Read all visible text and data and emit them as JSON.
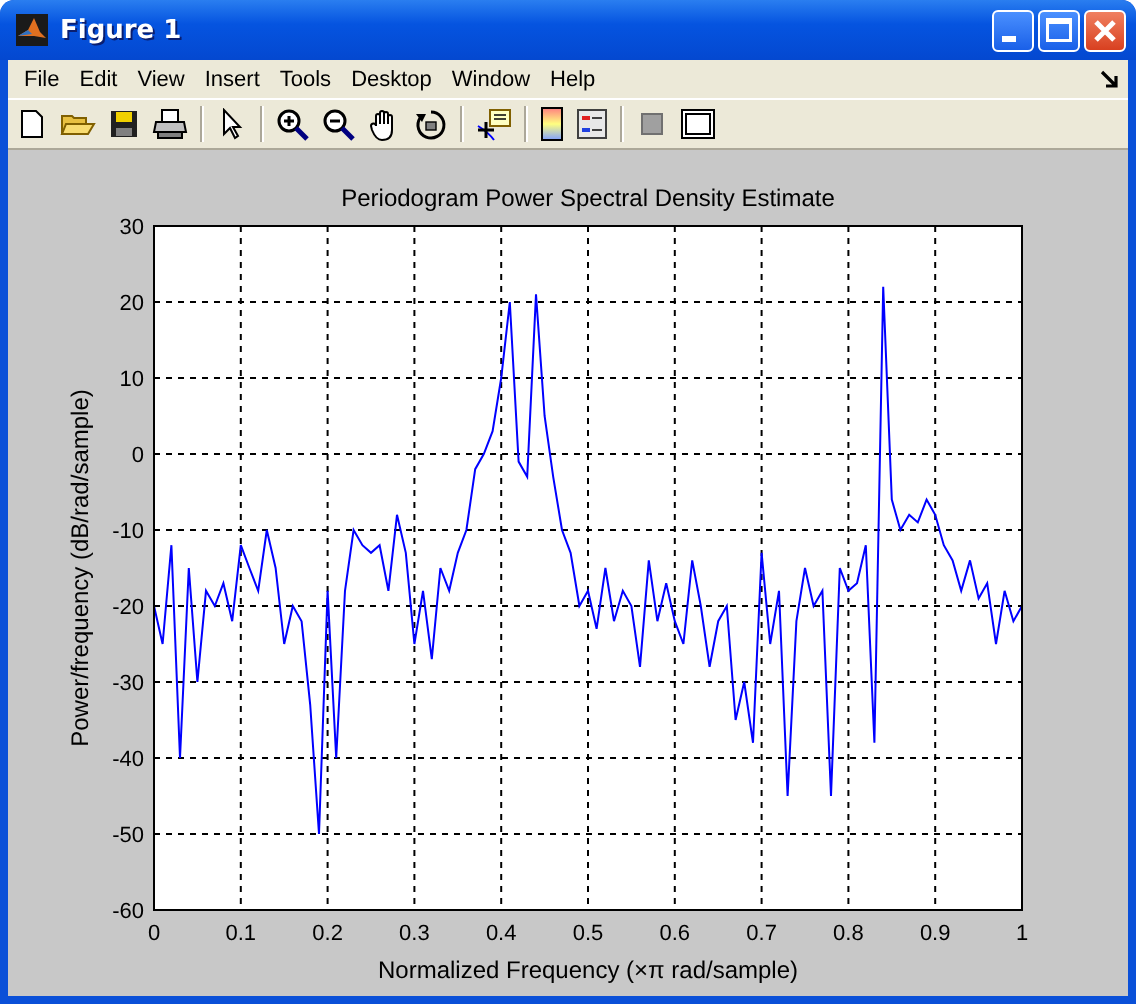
{
  "window": {
    "title": "Figure 1"
  },
  "menu": [
    {
      "label": "File"
    },
    {
      "label": "Edit"
    },
    {
      "label": "View"
    },
    {
      "label": "Insert"
    },
    {
      "label": "Tools"
    },
    {
      "label": "Desktop"
    },
    {
      "label": "Window"
    },
    {
      "label": "Help"
    }
  ],
  "toolbar": [
    {
      "kind": "new"
    },
    {
      "kind": "open"
    },
    {
      "kind": "save"
    },
    {
      "kind": "print"
    },
    {
      "kind": "sep"
    },
    {
      "kind": "pointer"
    },
    {
      "kind": "sep"
    },
    {
      "kind": "zoomin"
    },
    {
      "kind": "zoomout"
    },
    {
      "kind": "pan"
    },
    {
      "kind": "rotate"
    },
    {
      "kind": "sep"
    },
    {
      "kind": "datacursor"
    },
    {
      "kind": "sep"
    },
    {
      "kind": "colorbar"
    },
    {
      "kind": "legend"
    },
    {
      "kind": "sep"
    },
    {
      "kind": "hidetools"
    },
    {
      "kind": "showtools"
    }
  ],
  "plot": {
    "chart_data": {
      "type": "line",
      "title": "Periodogram Power Spectral Density Estimate",
      "xlabel": "Normalized Frequency  (×π rad/sample)",
      "ylabel": "Power/frequency (dB/rad/sample)",
      "grid": true,
      "xlim": [
        0,
        1
      ],
      "ylim": [
        -60,
        30
      ],
      "xticks": [
        0,
        0.1,
        0.2,
        0.3,
        0.4,
        0.5,
        0.6,
        0.7,
        0.8,
        0.9,
        1
      ],
      "yticks": [
        -60,
        -50,
        -40,
        -30,
        -20,
        -10,
        0,
        10,
        20,
        30
      ],
      "x": [
        0,
        0.01,
        0.02,
        0.03,
        0.04,
        0.05,
        0.06,
        0.07,
        0.08,
        0.09,
        0.1,
        0.11,
        0.12,
        0.13,
        0.14,
        0.15,
        0.16,
        0.17,
        0.18,
        0.19,
        0.2,
        0.21,
        0.22,
        0.23,
        0.24,
        0.25,
        0.26,
        0.27,
        0.28,
        0.29,
        0.3,
        0.31,
        0.32,
        0.33,
        0.34,
        0.35,
        0.36,
        0.37,
        0.38,
        0.39,
        0.4,
        0.41,
        0.42,
        0.43,
        0.44,
        0.45,
        0.46,
        0.47,
        0.48,
        0.49,
        0.5,
        0.51,
        0.52,
        0.53,
        0.54,
        0.55,
        0.56,
        0.57,
        0.58,
        0.59,
        0.6,
        0.61,
        0.62,
        0.63,
        0.64,
        0.65,
        0.66,
        0.67,
        0.68,
        0.69,
        0.7,
        0.71,
        0.72,
        0.73,
        0.74,
        0.75,
        0.76,
        0.77,
        0.78,
        0.79,
        0.8,
        0.81,
        0.82,
        0.83,
        0.84,
        0.85,
        0.86,
        0.87,
        0.88,
        0.89,
        0.9,
        0.91,
        0.92,
        0.93,
        0.94,
        0.95,
        0.96,
        0.97,
        0.98,
        0.99,
        1
      ],
      "series": [
        {
          "color": "#0000ff",
          "values": [
            -20,
            -25,
            -12,
            -40,
            -15,
            -30,
            -18,
            -20,
            -17,
            -22,
            -12,
            -15,
            -18,
            -10,
            -15,
            -25,
            -20,
            -22,
            -33,
            -50,
            -18,
            -40,
            -18,
            -10,
            -12,
            -13,
            -12,
            -18,
            -8,
            -13,
            -25,
            -18,
            -27,
            -15,
            -18,
            -13,
            -10,
            -2,
            0,
            3,
            10,
            20,
            -1,
            -3,
            21,
            5,
            -3,
            -10,
            -13,
            -20,
            -18,
            -23,
            -15,
            -22,
            -18,
            -20,
            -28,
            -14,
            -22,
            -17,
            -22,
            -25,
            -14,
            -20,
            -28,
            -22,
            -20,
            -35,
            -30,
            -38,
            -13,
            -25,
            -18,
            -45,
            -22,
            -15,
            -20,
            -18,
            -45,
            -15,
            -18,
            -17,
            -12,
            -38,
            22,
            -6,
            -10,
            -8,
            -9,
            -6,
            -8,
            -12,
            -14,
            -18,
            -14,
            -19,
            -17,
            -25,
            -18,
            -22,
            -20
          ]
        }
      ]
    }
  }
}
